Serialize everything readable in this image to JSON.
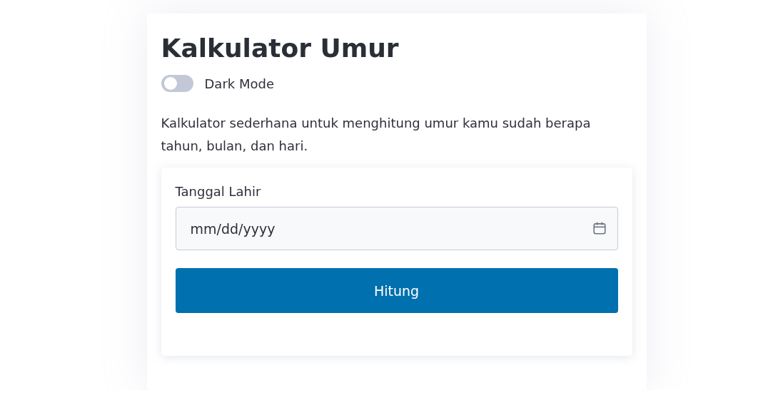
{
  "title": "Kalkulator Umur",
  "dark_mode": {
    "label": "Dark Mode",
    "on": false
  },
  "description": "Kalkulator sederhana untuk menghitung umur kamu sudah berapa tahun, bulan, dan hari.",
  "form": {
    "label": "Tanggal Lahir",
    "placeholder": "mm/dd/yyyy",
    "button": "Hitung"
  }
}
